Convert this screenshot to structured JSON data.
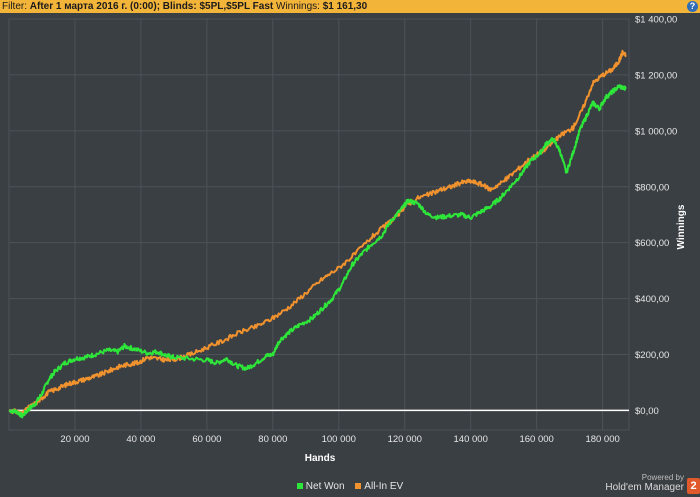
{
  "filter_bar": {
    "prefix": "Filter:",
    "text": "After 1 марта 2016 г. (0:00); Blinds: $5PL,$5PL Fast",
    "winnings_label": "Winnings:",
    "winnings_value": "$1 161,30",
    "help_icon": "question-mark-icon"
  },
  "branding": {
    "powered_by": "Powered by",
    "product": "Hold'em Manager",
    "badge": "2"
  },
  "colors": {
    "net_won": "#2ee63a",
    "all_in_ev": "#f0922e",
    "background": "#3a3f44",
    "grid": "#4d5258",
    "zero_line": "#ffffff",
    "topbar": "#f3b43a"
  },
  "chart_data": {
    "type": "line",
    "xlabel": "Hands",
    "ylabel": "Winnings",
    "xlim": [
      0,
      188000
    ],
    "ylim": [
      -70,
      1400
    ],
    "x_ticks": [
      20000,
      40000,
      60000,
      80000,
      100000,
      120000,
      140000,
      160000,
      180000
    ],
    "x_tick_labels": [
      "20 000",
      "40 000",
      "60 000",
      "80 000",
      "100 000",
      "120 000",
      "140 000",
      "160 000",
      "180 000"
    ],
    "y_ticks": [
      0,
      200,
      400,
      600,
      800,
      1000,
      1200,
      1400
    ],
    "y_tick_labels": [
      "$0,00",
      "$200,00",
      "$400,00",
      "$600,00",
      "$800,00",
      "$1 000,00",
      "$1 200,00",
      "$1 400,00"
    ],
    "y_axis_side": "right",
    "grid": true,
    "legend_position": "bottom",
    "series": [
      {
        "name": "Net Won",
        "color": "#2ee63a",
        "x": [
          0,
          2500,
          4000,
          6000,
          8000,
          10000,
          12000,
          14000,
          17000,
          20000,
          23000,
          26000,
          30000,
          33000,
          35000,
          38000,
          42000,
          45000,
          48000,
          50000,
          55000,
          60000,
          63000,
          66000,
          69000,
          72000,
          75000,
          78000,
          80000,
          82000,
          85000,
          88000,
          92000,
          95000,
          98000,
          101000,
          104000,
          107000,
          110000,
          113000,
          116000,
          119000,
          121000,
          124000,
          127000,
          130000,
          133000,
          137000,
          140000,
          143000,
          146000,
          149000,
          152000,
          155000,
          158000,
          161000,
          163000,
          165000,
          167000,
          169000,
          171000,
          173000,
          175000,
          177000,
          179000,
          181000,
          183000,
          185000,
          187000
        ],
        "y": [
          0,
          -5,
          -20,
          5,
          25,
          60,
          110,
          140,
          170,
          185,
          190,
          200,
          215,
          210,
          230,
          220,
          205,
          210,
          195,
          190,
          185,
          180,
          170,
          185,
          160,
          150,
          170,
          195,
          200,
          250,
          280,
          305,
          330,
          365,
          400,
          450,
          520,
          560,
          595,
          625,
          680,
          720,
          750,
          740,
          700,
          690,
          695,
          700,
          690,
          710,
          730,
          760,
          800,
          840,
          890,
          920,
          955,
          970,
          930,
          850,
          920,
          1000,
          1050,
          1100,
          1080,
          1120,
          1140,
          1160,
          1150
        ]
      },
      {
        "name": "All-In EV",
        "color": "#f0922e",
        "x": [
          0,
          2500,
          4000,
          6000,
          8000,
          10000,
          12000,
          15000,
          18000,
          21000,
          24000,
          27000,
          30000,
          33000,
          36000,
          39000,
          42000,
          45000,
          48000,
          51000,
          55000,
          60000,
          65000,
          70000,
          75000,
          80000,
          85000,
          90000,
          95000,
          100000,
          105000,
          110000,
          115000,
          118000,
          120000,
          124000,
          128000,
          131000,
          134000,
          137000,
          140000,
          143000,
          146000,
          150000,
          154000,
          158000,
          162000,
          165000,
          168000,
          171000,
          174000,
          177000,
          180000,
          183000,
          185000,
          186000,
          187000
        ],
        "y": [
          0,
          -5,
          -12,
          10,
          25,
          45,
          65,
          80,
          95,
          105,
          115,
          125,
          140,
          155,
          165,
          170,
          190,
          185,
          180,
          185,
          200,
          225,
          250,
          280,
          300,
          330,
          370,
          420,
          470,
          510,
          560,
          620,
          670,
          700,
          730,
          760,
          775,
          790,
          800,
          815,
          820,
          810,
          790,
          820,
          860,
          900,
          930,
          960,
          990,
          1010,
          1080,
          1170,
          1200,
          1220,
          1250,
          1280,
          1270
        ]
      }
    ]
  }
}
